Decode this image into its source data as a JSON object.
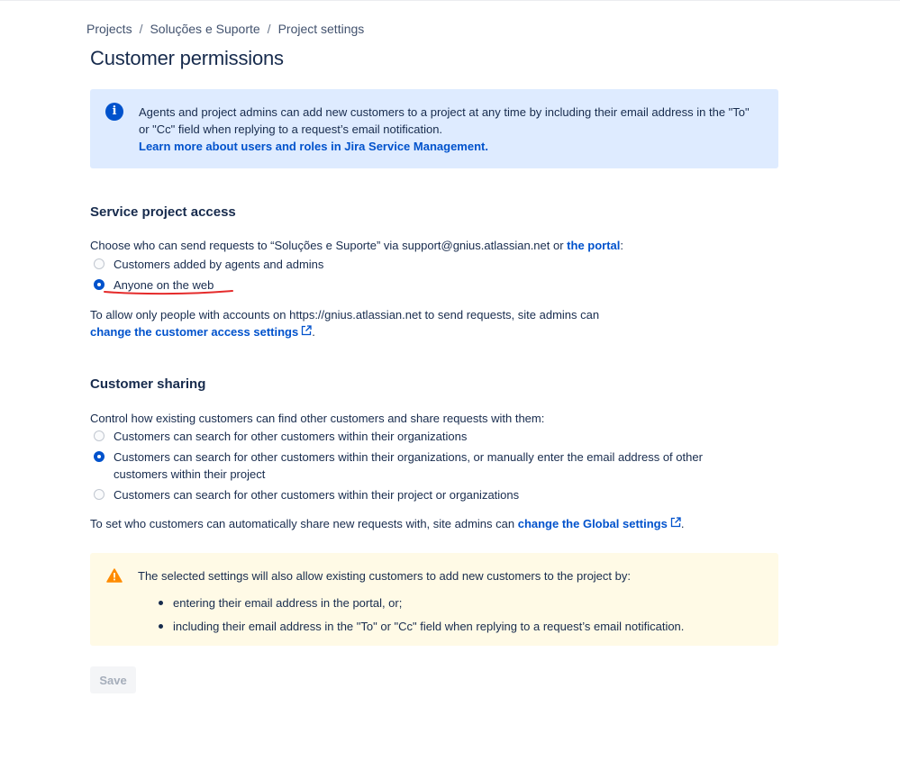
{
  "breadcrumb": [
    "Projects",
    "Soluções e Suporte",
    "Project settings"
  ],
  "page_title": "Customer permissions",
  "info_panel": {
    "text": "Agents and project admins can add new customers to a project at any time by including their email address in the \"To\" or \"Cc\" field when replying to a request’s email notification.",
    "link": "Learn more about users and roles in Jira Service Management."
  },
  "service_access": {
    "heading": "Service project access",
    "description_prefix": "Choose who can send requests to “Soluções e Suporte” via support@gnius.atlassian.net or ",
    "description_link": "the portal",
    "description_suffix": ":",
    "options": [
      {
        "label": "Customers added by agents and admins",
        "checked": false
      },
      {
        "label": "Anyone on the web",
        "checked": true
      }
    ],
    "note": "To allow only people with accounts on https://gnius.atlassian.net to send requests, site admins can",
    "note_link": "change the customer access settings",
    "note_end": "."
  },
  "customer_sharing": {
    "heading": "Customer sharing",
    "description": "Control how existing customers can find other customers and share requests with them:",
    "options": [
      {
        "label": "Customers can search for other customers within their organizations",
        "checked": false
      },
      {
        "label": "Customers can search for other customers within their organizations, or manually enter the email address of other customers within their project",
        "checked": true
      },
      {
        "label": "Customers can search for other customers within their project or organizations",
        "checked": false
      }
    ],
    "note": "To set who customers can automatically share new requests with, site admins can ",
    "note_link": "change the Global settings",
    "note_end": "."
  },
  "warning_panel": {
    "text": "The selected settings will also allow existing customers to add new customers to the project by:",
    "items": [
      "entering their email address in the portal, or;",
      "including their email address in the \"To\" or \"Cc\" field when replying to a request’s email notification."
    ]
  },
  "save_label": "Save",
  "colors": {
    "link": "#0052CC",
    "info_bg": "#DEEBFF",
    "warn_bg": "#FFFAE6",
    "annotation": "#E52B2B"
  },
  "icons": {
    "info": "info-circle-icon",
    "warning": "warning-triangle-icon",
    "external": "external-link-icon"
  }
}
